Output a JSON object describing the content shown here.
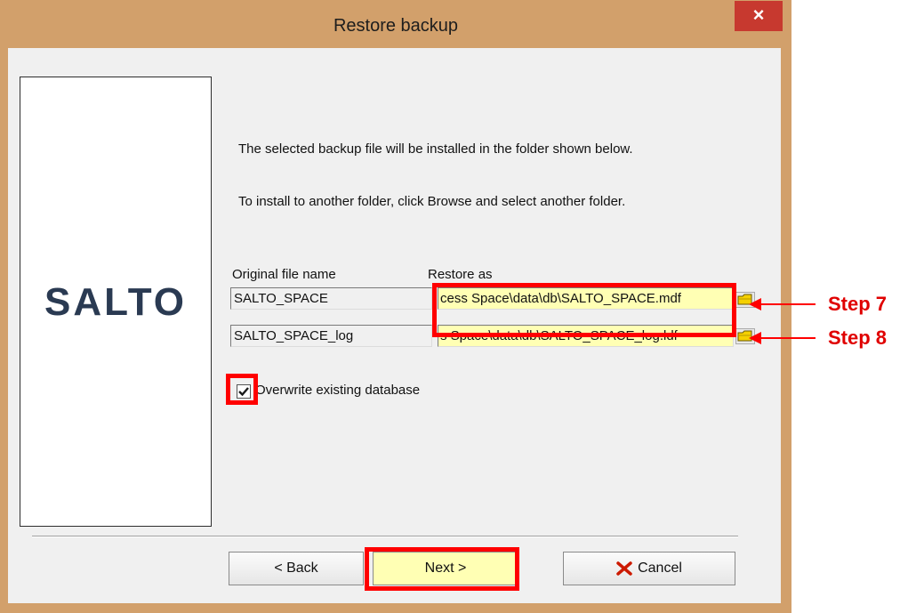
{
  "window": {
    "title": "Restore backup",
    "close_glyph": "×"
  },
  "logo": {
    "text": "SALTO"
  },
  "instructions": {
    "line1": "The selected backup file will be installed in the folder shown below.",
    "line2": "To install to another folder, click Browse and select another folder."
  },
  "table": {
    "header_original": "Original file name",
    "header_restore": "Restore as",
    "rows": [
      {
        "original": "SALTO_SPACE",
        "restore_as": "cess Space\\data\\db\\SALTO_SPACE.mdf"
      },
      {
        "original": "SALTO_SPACE_log",
        "restore_as": "s Space\\data\\db\\SALTO_SPACE_log.ldf"
      }
    ]
  },
  "overwrite": {
    "label": "Overwrite existing database",
    "checked": true
  },
  "buttons": {
    "back": "< Back",
    "next": "Next >",
    "cancel": "Cancel"
  },
  "annotations": {
    "step7": "Step 7",
    "step8": "Step 8",
    "highlight_color": "#ff0000"
  },
  "colors": {
    "frame": "#d2a06b",
    "close": "#c7392f",
    "highlight_field": "#ffffb4"
  },
  "icons": [
    "folder-icon",
    "checkmark-icon",
    "cancel-x-icon",
    "close-icon"
  ]
}
